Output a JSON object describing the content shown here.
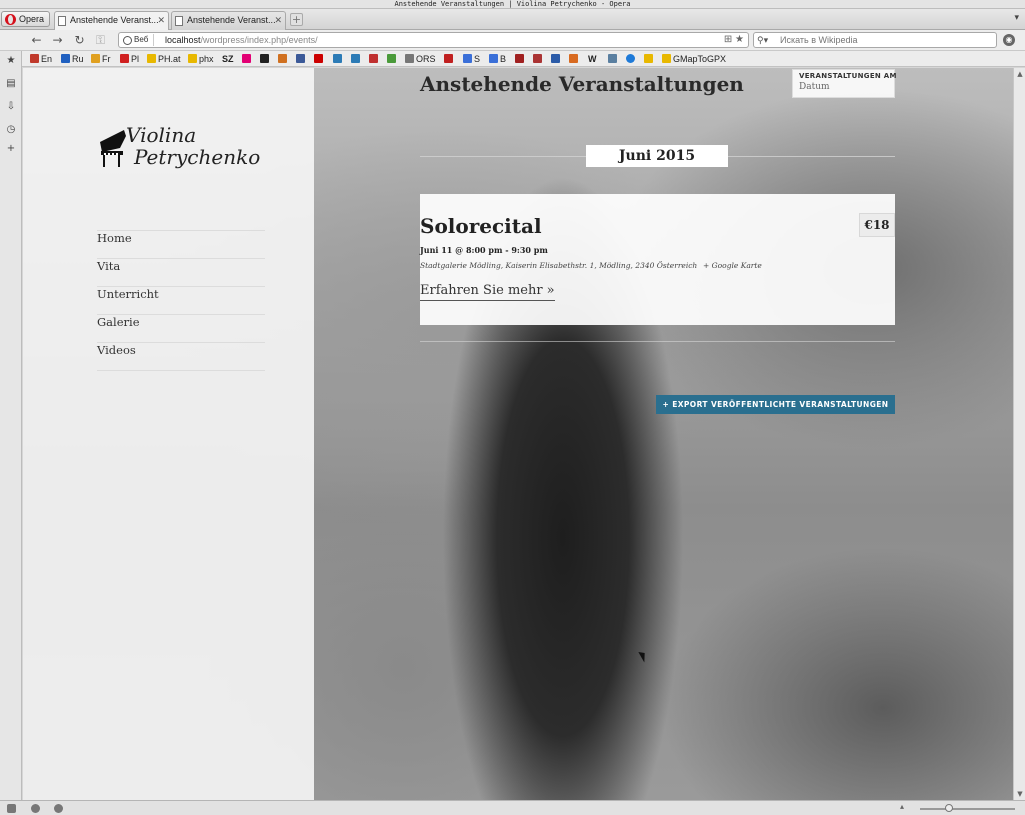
{
  "window": {
    "title": "Anstehende Veranstaltungen | Violina Petrychenko - Opera"
  },
  "browser": {
    "menu_label": "Opera",
    "tabs": [
      {
        "label": "Anstehende Veranst..."
      },
      {
        "label": "Anstehende Veranst..."
      }
    ],
    "address": {
      "badge": "Веб",
      "url_host": "localhost",
      "url_path": "/wordpress/index.php/events/"
    },
    "search": {
      "placeholder": "Искать в Wikipedia"
    },
    "bookmarks": [
      {
        "label": "En",
        "color": "#c0392b"
      },
      {
        "label": "Ru",
        "color": "#2060c0"
      },
      {
        "label": "Fr",
        "color": "#e0a020"
      },
      {
        "label": "Pl",
        "color": "#d02020"
      },
      {
        "label": "PH.at",
        "color": "#e8b800"
      },
      {
        "label": "phx",
        "color": "#e8b800"
      },
      {
        "label": "ORS",
        "color": "#777777"
      },
      {
        "label": "S",
        "color": "#3a6fd8"
      },
      {
        "label": "B",
        "color": "#3a6fd8"
      },
      {
        "label": "GMapToGPX",
        "color": "#e8b800"
      }
    ],
    "bookmark_sz": "SZ",
    "bookmark_w": "W"
  },
  "site": {
    "logo_line1": "Violina",
    "logo_line2": "Petrychenko",
    "nav": [
      "Home",
      "Vita",
      "Unterricht",
      "Galerie",
      "Videos"
    ],
    "page_title": "Anstehende Veranstaltungen",
    "date_filter": {
      "label": "VERANSTALTUNGEN AM",
      "value": "Datum"
    },
    "month": "Juni 2015",
    "event": {
      "title": "Solorecital",
      "price": "€18",
      "when": "Juni 11 @ 8:00 pm - 9:30 pm",
      "venue": "Stadtgalerie Mödling, Kaiserin Elisabethstr. 1, Mödling, 2340 Österreich",
      "map_link": "+ Google Karte",
      "more": "Erfahren Sie mehr »"
    },
    "export_button": "+ EXPORT VERÖFFENTLICHTE VERANSTALTUNGEN"
  },
  "colors": {
    "export_button": "#2a6f8f",
    "opera_red": "#d5101c"
  }
}
